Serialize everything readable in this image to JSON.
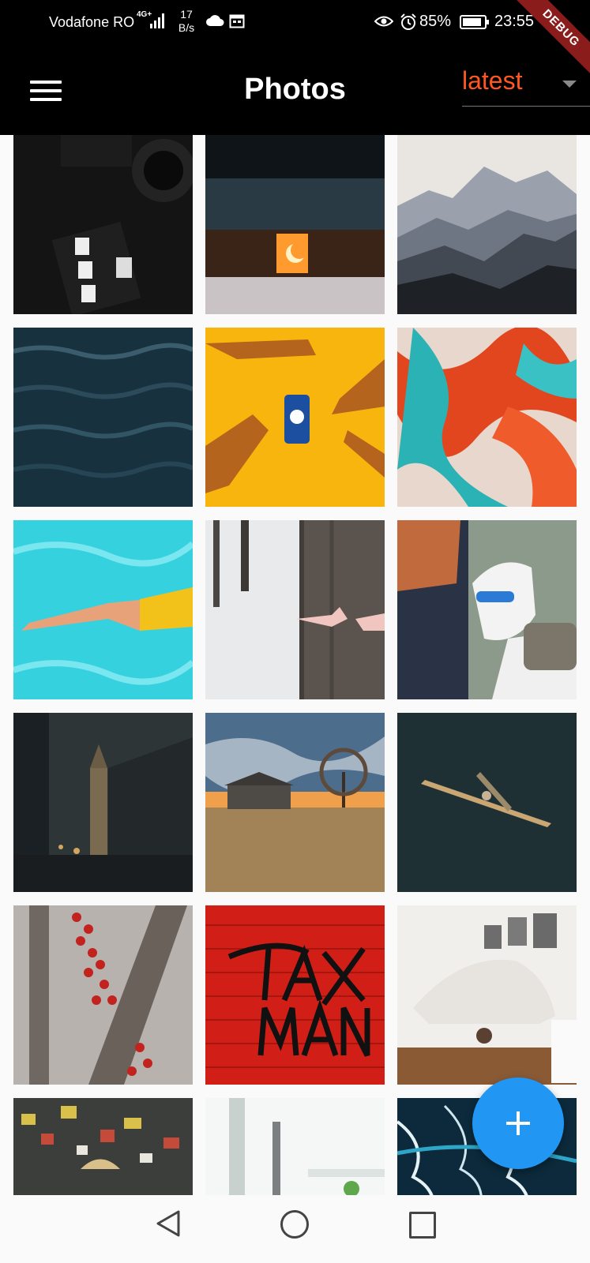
{
  "status_bar": {
    "carrier": "Vodafone RO",
    "network": "4G+",
    "speed_value": "17",
    "speed_unit": "B/s",
    "battery": "85%",
    "time": "23:55"
  },
  "app_bar": {
    "title": "Photos",
    "sort_value": "latest",
    "debug_label": "DEBUG"
  },
  "photos": [
    {
      "description": "camera and memory cards"
    },
    {
      "description": "cabin at night with moon"
    },
    {
      "description": "misty mountains"
    },
    {
      "description": "dark ocean water"
    },
    {
      "description": "pepsi can with hand shadows"
    },
    {
      "description": "abstract paint swirls"
    },
    {
      "description": "swimmer in pool"
    },
    {
      "description": "tree with painted hands in snow"
    },
    {
      "description": "white dog with owner"
    },
    {
      "description": "town street with tower"
    },
    {
      "description": "field with cabin and tree at sunset"
    },
    {
      "description": "rower on dark water"
    },
    {
      "description": "red berries on branch"
    },
    {
      "description": "graffiti on red brick wall"
    },
    {
      "description": "child in blanket fort"
    },
    {
      "description": "street market stall"
    },
    {
      "description": "window and plant"
    },
    {
      "description": "ocean waves aerial"
    }
  ],
  "colors": {
    "accent": "#ff5722",
    "fab": "#2196f3",
    "app_bar": "#000000"
  }
}
